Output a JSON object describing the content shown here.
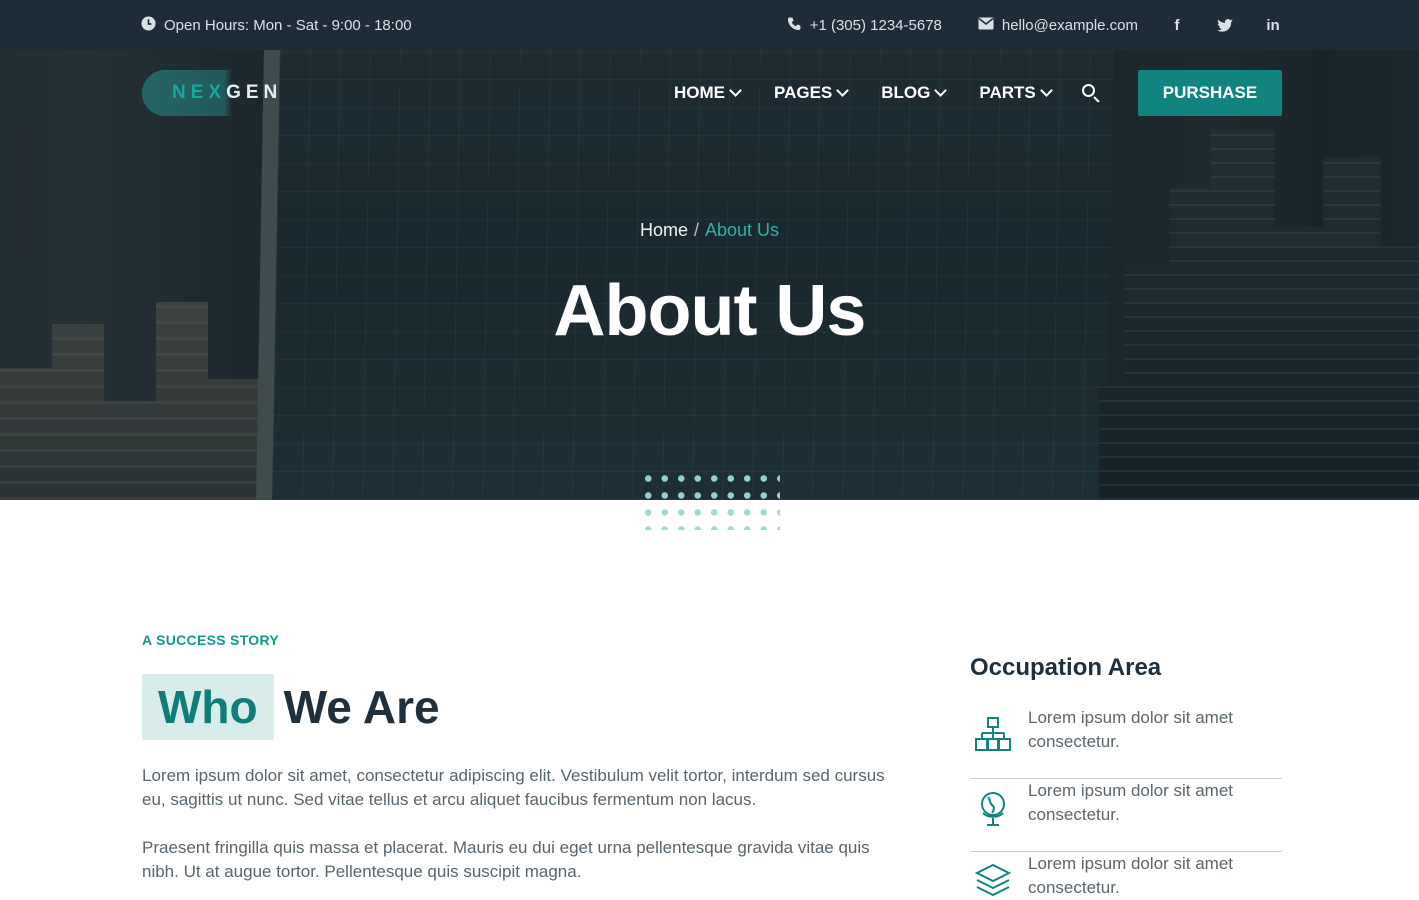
{
  "topbar": {
    "hours": "Open Hours: Mon - Sat - 9:00 - 18:00",
    "phone": "+1 (305) 1234-5678",
    "email": "hello@example.com",
    "social": {
      "facebook": "f",
      "twitter": "t",
      "linkedin": "in"
    }
  },
  "logo": {
    "part1": "NEX",
    "part2": "GEN"
  },
  "nav": {
    "items": [
      {
        "label": "HOME"
      },
      {
        "label": "PAGES"
      },
      {
        "label": "BLOG"
      },
      {
        "label": "PARTS"
      }
    ],
    "cta": "PURSHASE"
  },
  "hero": {
    "breadcrumb": {
      "home": "Home",
      "separator": "/",
      "current": "About Us"
    },
    "title": "About Us"
  },
  "about": {
    "eyebrow": "A SUCCESS STORY",
    "heading_highlight": "Who",
    "heading_rest": "We Are",
    "paragraphs": [
      "Lorem ipsum dolor sit amet, consectetur adipiscing elit. Vestibulum velit tortor, interdum sed cursus eu, sagittis ut nunc. Sed vitae tellus et arcu aliquet faucibus fermentum non lacus.",
      "Praesent fringilla quis massa et placerat. Mauris eu dui eget urna pellentesque gravida vitae quis nibh. Ut at augue tortor. Pellentesque quis suscipit magna."
    ]
  },
  "sidebar": {
    "title": "Occupation Area",
    "items": [
      {
        "icon": "hierarchy-icon",
        "text": "Lorem ipsum dolor sit amet consectetur."
      },
      {
        "icon": "globe-icon",
        "text": "Lorem ipsum dolor sit amet consectetur."
      },
      {
        "icon": "layers-icon",
        "text": "Lorem ipsum dolor sit amet consectetur."
      }
    ]
  },
  "colors": {
    "accent": "#11847f",
    "topbar": "#1d2c38",
    "highlight_bg": "#d7eceb",
    "heading": "#1f2f3b"
  }
}
